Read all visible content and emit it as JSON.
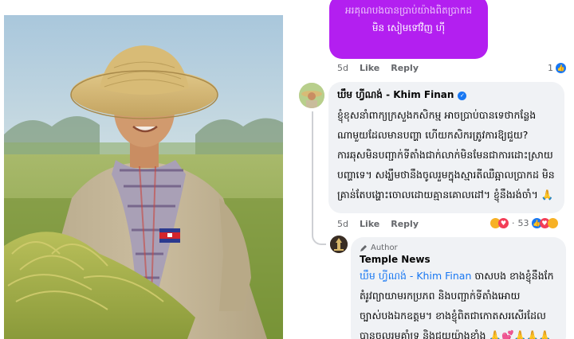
{
  "photo": {
    "description_icon": "person-photo"
  },
  "top_reply": {
    "bubble_line1": "អរគុណបងបានប្រាប់យ៉ាងពិតប្រាកដ",
    "bubble_line2": "មិន សៀមទៅវិញ ហ៊ី",
    "time": "5d",
    "like_label": "Like",
    "reply_label": "Reply",
    "reaction_count": "1",
    "reaction_icon": "like-icon"
  },
  "main_comment": {
    "author": "ឃឹម ហ្វីណង់ - Khim Finan",
    "verified_icon": "verified-badge-icon",
    "body": "ខ្ញុំខុសនាំពាក្យក្រសួងកសិកម្ម អាចប្រាប់បានទេថាកន្លែងណាមួយដែលមានបញ្ហា ហើយកសិករត្រូវការឱ្យជួយ? ការឆុសមិនបញ្ជាក់ទីតាំងជាក់លាក់មិនមែនជាការដោះស្រាយបញ្ហាទេ។ សង្ឃឹមថានឹងចូលរួមក្នុងស្មារតីឈឺឆ្អាលប្រាកដ មិនគ្រាន់តែបង្ហោះចោលដោយគ្មានគោលដៅ។ ខ្ញុំនឹងរង់ចាំ។ 🙏",
    "time": "5d",
    "like_label": "Like",
    "reply_label": "Reply",
    "reaction_count": "53",
    "reaction_icons": [
      "haha-icon",
      "love-icon",
      "like-icon"
    ]
  },
  "nested_reply": {
    "author_tag": "Author",
    "author": "Temple News",
    "mention": "ឃឹម ហ្វីណង់ - Khim Finan",
    "body": "ចាសបង ខាងខ្ញុំនឹងកែតំរូវព្យាយាមរកប្រភព និងបញ្ជាក់ទីតាំងអោយច្បាស់បងឯកឧត្តម។ ខាងខ្ញុំពិតជាកោតសរសើរដែលបានចូលរួមគាំទ្រ និងជួយយ៉ាងខ្លាំង 🙏💕🙏🙏🙏"
  }
}
